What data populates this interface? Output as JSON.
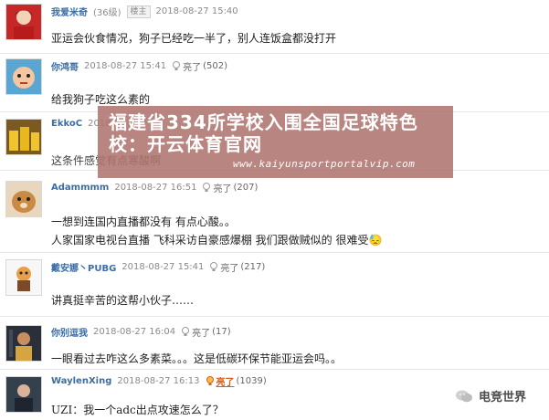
{
  "posts": [
    {
      "username": "我爱米奇",
      "level": "(36级)",
      "badge": "楼主",
      "timestamp": "2018-08-27 15:40",
      "lines": [
        "亚运会伙食情况，狗子已经吃一半了，别人连饭盒都没打开"
      ]
    },
    {
      "username": "你鸿哥",
      "timestamp": "2018-08-27 15:41",
      "like_label": "亮了",
      "like_count": "(502)",
      "lines": [
        "给我狗子吃这么素的"
      ]
    },
    {
      "username": "EkkoC",
      "timestamp": "2018-",
      "lines": [
        "这条件感觉有点寒酸啊"
      ]
    },
    {
      "username": "Adammmm",
      "timestamp": "2018-08-27 16:51",
      "like_label": "亮了",
      "like_count": "(207)",
      "lines": [
        "一想到连国内直播都没有 有点心酸。。",
        "人家国家电视台直播 飞科采访自豪感爆棚 我们跟做贼似的 很难受😓"
      ]
    },
    {
      "username": "戴安娜丶PUBG",
      "timestamp": "2018-08-27 15:41",
      "like_label": "亮了",
      "like_count": "(217)",
      "lines": [
        "讲真挺辛苦的这帮小伙子……"
      ]
    },
    {
      "username": "你别逗我",
      "timestamp": "2018-08-27 16:04",
      "like_label": "亮了",
      "like_count": "(17)",
      "lines": [
        "一眼看过去咋这么多素菜。。。这是低碳环保节能亚运会吗。。"
      ]
    },
    {
      "username": "WaylenXing",
      "timestamp": "2018-08-27 16:13",
      "like_label": "亮了",
      "like_count": "(1039)",
      "lines": [
        "UZI：我一个adc出点攻速怎么了？"
      ]
    }
  ],
  "banner": {
    "title": "福建省334所学校入围全国足球特色校：开云体育官网",
    "url": "www.kaiyunsportportalvip.com"
  },
  "watermark": {
    "text": "电竞世界"
  },
  "colors": {
    "username": "#3b6ea5",
    "meta": "#8a8a8a",
    "banner": "#ae746e",
    "like_highlight": "#e05b1a"
  },
  "icons": {
    "like": "lightbulb-icon",
    "watermark": "wechat-bubble-icon"
  }
}
